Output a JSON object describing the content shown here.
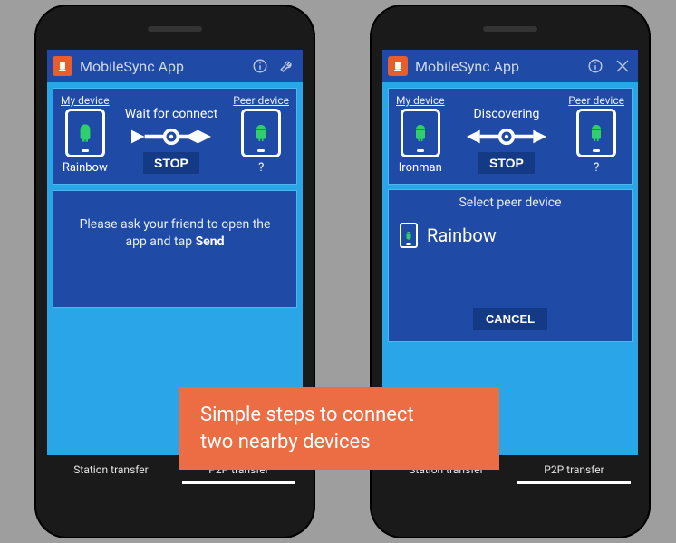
{
  "app": {
    "title": "MobileSync App"
  },
  "labels": {
    "my_device": "My device",
    "peer_device": "Peer device"
  },
  "left": {
    "status": "Wait for connect",
    "stop": "STOP",
    "my_name": "Rainbow",
    "peer_name": "?",
    "message_pre": "Please ask your friend to open the app and tap ",
    "message_bold": "Send"
  },
  "right": {
    "status": "Discovering",
    "stop": "STOP",
    "my_name": "Ironman",
    "peer_name": "?",
    "dialog_title": "Select peer device",
    "peer_option": "Rainbow",
    "cancel": "CANCEL"
  },
  "tabs": {
    "station": "Station transfer",
    "p2p": "P2P transfer"
  },
  "caption": {
    "line1": "Simple steps to connect",
    "line2": "two nearby devices"
  }
}
